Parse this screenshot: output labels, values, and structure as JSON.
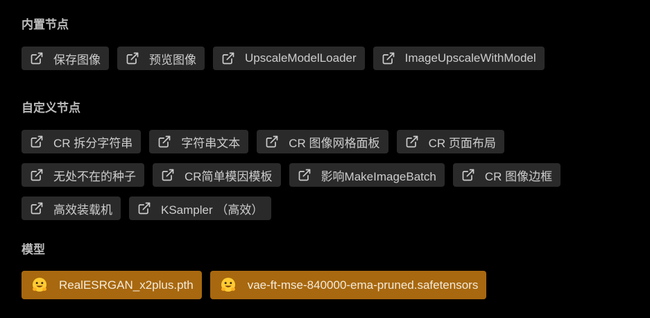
{
  "builtin": {
    "title": "内置节点",
    "nodes": [
      "保存图像",
      "预览图像",
      "UpscaleModelLoader",
      "ImageUpscaleWithModel"
    ],
    "icon": "external-link-icon"
  },
  "custom": {
    "title": "自定义节点",
    "rows": [
      [
        "CR 拆分字符串",
        "字符串文本",
        "CR 图像网格面板",
        "CR 页面布局"
      ],
      [
        "无处不在的种子",
        "CR简单模因模板",
        "影响MakeImageBatch",
        "CR 图像边框"
      ],
      [
        "高效装载机",
        "KSampler （高效）"
      ]
    ],
    "icon": "external-link-icon"
  },
  "models": {
    "title": "模型",
    "items": [
      "RealESRGAN_x2plus.pth",
      "vae-ft-mse-840000-ema-pruned.safetensors"
    ],
    "icon": "hugging-face-icon"
  },
  "colors": {
    "background": "#000000",
    "chip": "#2a2a2a",
    "model_chip": "#a8680f",
    "text": "#cdcdcd"
  }
}
